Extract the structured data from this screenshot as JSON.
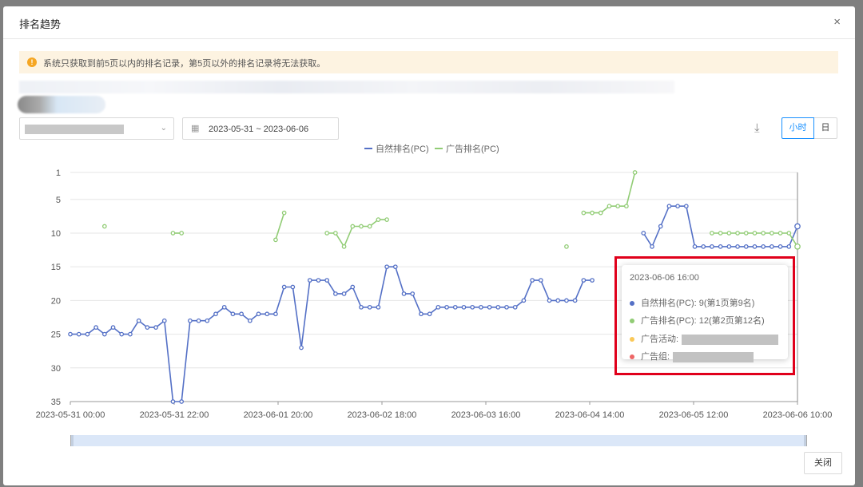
{
  "modal": {
    "title": "排名趋势",
    "close_icon": "×",
    "close_button": "关闭"
  },
  "alert": {
    "icon": "!",
    "text": "系统只获取到前5页以内的排名记录，第5页以外的排名记录将无法获取。"
  },
  "filters": {
    "date_range": "2023-05-31  ~  2023-06-06",
    "granularity_hour": "小时",
    "granularity_day": "日"
  },
  "colors": {
    "natural": "#5470c6",
    "ad": "#91cc75",
    "campaign": "#fac858",
    "adgroup": "#ee6666"
  },
  "chart_data": {
    "type": "line",
    "title": "",
    "legend": [
      "自然排名(PC)",
      "广告排名(PC)"
    ],
    "legend_position": "top-center",
    "y_inverted": true,
    "ylim": [
      1,
      35
    ],
    "y_ticks": [
      1,
      5,
      10,
      15,
      20,
      25,
      30,
      35
    ],
    "x_tick_labels": [
      "2023-05-31 00:00",
      "2023-05-31 22:00",
      "2023-06-01 20:00",
      "2023-06-02 18:00",
      "2023-06-03 16:00",
      "2023-06-04 14:00",
      "2023-06-05 12:00",
      "2023-06-06 10:00"
    ],
    "series": [
      {
        "name": "自然排名(PC)",
        "values": [
          25,
          25,
          25,
          24,
          25,
          24,
          25,
          25,
          23,
          24,
          24,
          23,
          35,
          35,
          23,
          23,
          23,
          22,
          21,
          22,
          22,
          23,
          22,
          22,
          22,
          18,
          18,
          27,
          17,
          17,
          17,
          19,
          19,
          18,
          21,
          21,
          21,
          15,
          15,
          19,
          19,
          22,
          22,
          21,
          21,
          21,
          21,
          21,
          21,
          21,
          21,
          21,
          21,
          20,
          17,
          17,
          20,
          20,
          20,
          20,
          17,
          17,
          null,
          null,
          null,
          null,
          null,
          10,
          12,
          9,
          6,
          6,
          6,
          12,
          12,
          12,
          12,
          12,
          12,
          12,
          12,
          12,
          12,
          12,
          12,
          9
        ]
      },
      {
        "name": "广告排名(PC)",
        "values": [
          null,
          null,
          null,
          null,
          9,
          null,
          null,
          null,
          null,
          null,
          null,
          null,
          10,
          10,
          null,
          null,
          null,
          null,
          null,
          null,
          null,
          null,
          null,
          null,
          11,
          7,
          null,
          null,
          null,
          null,
          10,
          10,
          12,
          9,
          9,
          9,
          8,
          8,
          null,
          null,
          null,
          null,
          null,
          null,
          null,
          null,
          null,
          null,
          null,
          null,
          null,
          null,
          null,
          null,
          null,
          null,
          null,
          null,
          12,
          null,
          7,
          7,
          7,
          6,
          6,
          6,
          1,
          null,
          null,
          null,
          null,
          null,
          null,
          null,
          null,
          10,
          10,
          10,
          10,
          10,
          10,
          10,
          10,
          10,
          10,
          12
        ]
      }
    ]
  },
  "tooltip": {
    "time": "2023-06-06 16:00",
    "natural": "自然排名(PC): 9(第1页第9名)",
    "ad": "广告排名(PC): 12(第2页第12名)",
    "campaign_label": "广告活动:",
    "adgroup_label": "广告组:"
  }
}
